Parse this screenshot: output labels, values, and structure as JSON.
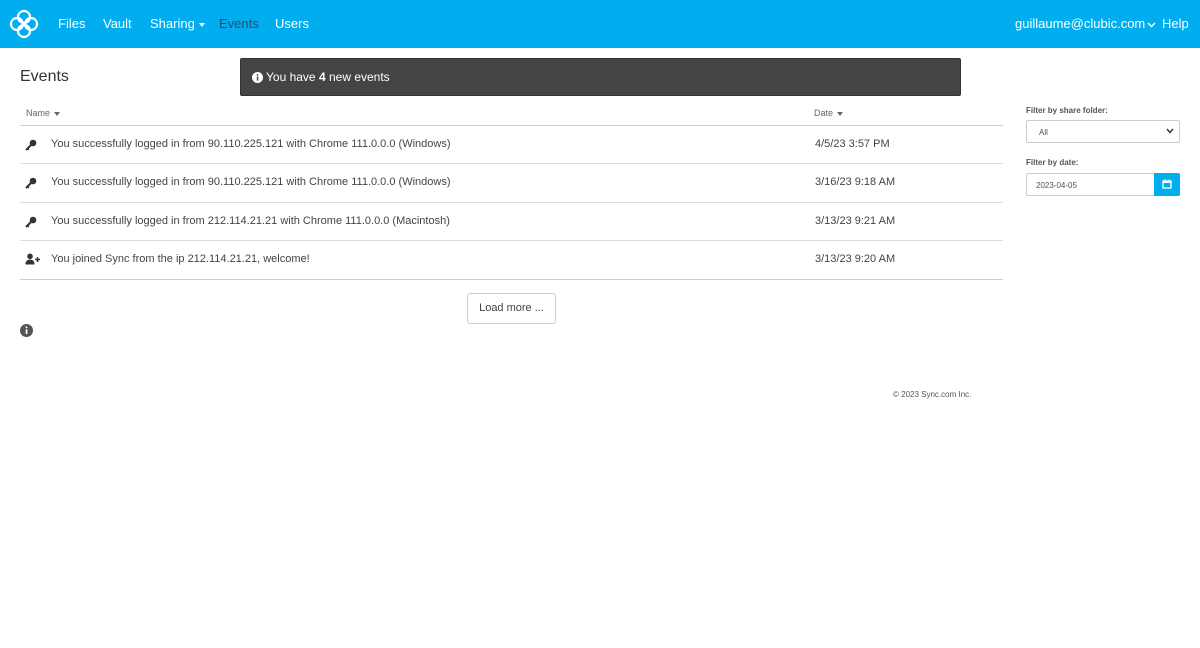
{
  "nav": {
    "items": [
      {
        "label": "Files"
      },
      {
        "label": "Vault"
      },
      {
        "label": "Sharing"
      },
      {
        "label": "Events"
      },
      {
        "label": "Users"
      }
    ],
    "account": "guillaume@clubic.com",
    "help": "Help"
  },
  "page": {
    "title": "Events",
    "notice": {
      "prefix": "You have ",
      "count": "4",
      "suffix": " new events"
    }
  },
  "table": {
    "headers": {
      "name": "Name",
      "date": "Date"
    },
    "rows": [
      {
        "icon": "key-icon",
        "name": "You successfully logged in from 90.110.225.121 with Chrome 111.0.0.0 (Windows)",
        "date": "4/5/23 3:57 PM"
      },
      {
        "icon": "key-icon",
        "name": "You successfully logged in from 90.110.225.121 with Chrome 111.0.0.0 (Windows)",
        "date": "3/16/23 9:18 AM"
      },
      {
        "icon": "key-icon",
        "name": "You successfully logged in from 212.114.21.21 with Chrome 111.0.0.0 (Macintosh)",
        "date": "3/13/23 9:21 AM"
      },
      {
        "icon": "user-plus-icon",
        "name": "You joined Sync from the ip 212.114.21.21, welcome!",
        "date": "3/13/23 9:20 AM"
      }
    ],
    "load_more": "Load more ..."
  },
  "filters": {
    "share_folder_label": "Filter by share folder:",
    "share_folder_value": "All",
    "date_label": "Filter by date:",
    "date_value": "2023-04-05"
  },
  "footer": {
    "copyright": "© 2023 Sync.com Inc."
  },
  "colors": {
    "brand": "#00aeef",
    "notice_bg": "#444444",
    "active_nav": "#2f4a6b"
  }
}
